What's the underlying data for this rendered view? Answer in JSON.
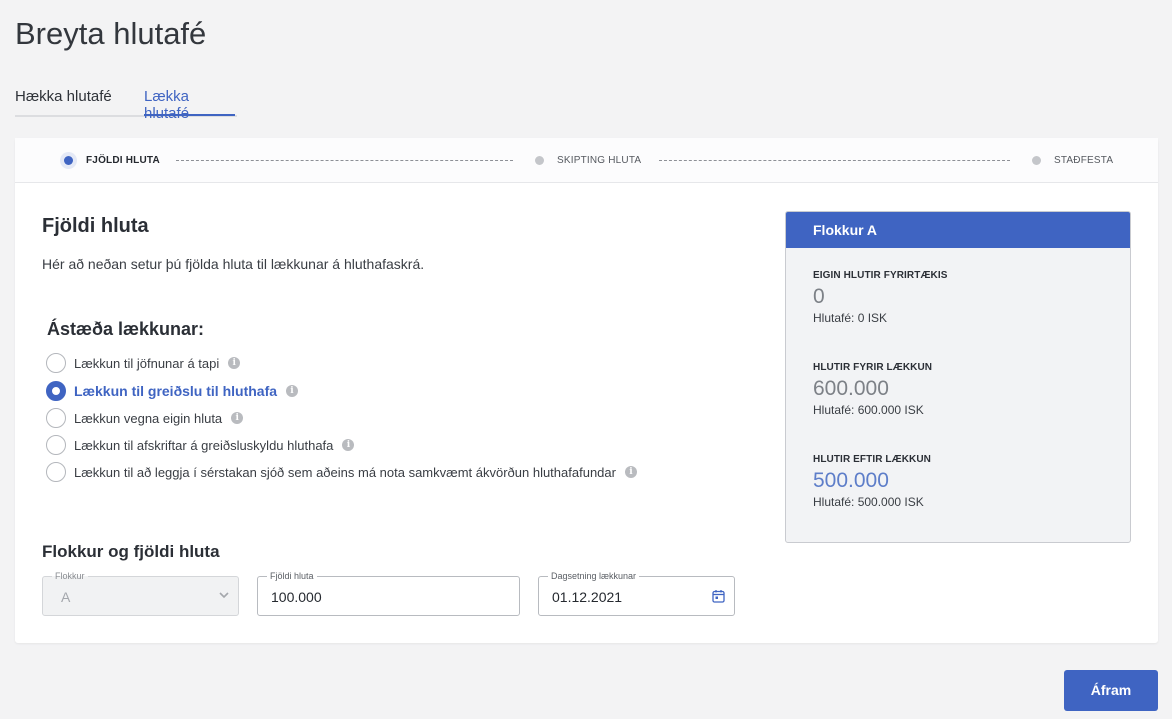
{
  "page_title": "Breyta hlutafé",
  "tabs": [
    {
      "label": "Hækka hlutafé",
      "active": false
    },
    {
      "label": "Lækka hlutafé",
      "active": true
    }
  ],
  "stepper": {
    "steps": [
      {
        "label": "FJÖLDI HLUTA",
        "active": true
      },
      {
        "label": "SKIPTING HLUTA",
        "active": false
      },
      {
        "label": "STAÐFESTA",
        "active": false
      }
    ]
  },
  "main": {
    "title": "Fjöldi hluta",
    "description": "Hér að neðan setur þú fjölda hluta til lækkunar á hluthafaskrá.",
    "reason_title": "Ástæða lækkunar:",
    "reasons": [
      {
        "label": "Lækkun til jöfnunar á tapi",
        "selected": false
      },
      {
        "label": "Lækkun til greiðslu til hluthafa",
        "selected": true
      },
      {
        "label": "Lækkun vegna eigin hluta",
        "selected": false
      },
      {
        "label": "Lækkun til afskriftar á greiðsluskyldu hluthafa",
        "selected": false
      },
      {
        "label": "Lækkun til að leggja í sérstakan sjóð sem aðeins má nota samkvæmt ákvörðun hluthafafundar",
        "selected": false
      }
    ],
    "fields_title": "Flokkur og fjöldi hluta",
    "fields": {
      "class": {
        "legend": "Flokkur",
        "value": "A"
      },
      "count": {
        "legend": "Fjöldi hluta",
        "value": "100.000"
      },
      "date": {
        "legend": "Dagsetning lækkunar",
        "value": "01.12.2021"
      }
    }
  },
  "summary": {
    "header": "Flokkur A",
    "blocks": [
      {
        "label": "EIGIN HLUTIR FYRIRTÆKIS",
        "value": "0",
        "sub": "Hlutafé: 0 ISK"
      },
      {
        "label": "HLUTIR FYRIR LÆKKUN",
        "value": "600.000",
        "sub": "Hlutafé: 600.000 ISK"
      },
      {
        "label": "HLUTIR EFTIR LÆKKUN",
        "value": "500.000",
        "sub": "Hlutafé: 500.000 ISK"
      }
    ]
  },
  "continue_label": "Áfram",
  "colors": {
    "accent": "#3f64c2",
    "background": "#f3f3f4"
  },
  "icons": {
    "info": "info-icon",
    "select": "chevron-down-icon",
    "date": "calendar-icon"
  }
}
